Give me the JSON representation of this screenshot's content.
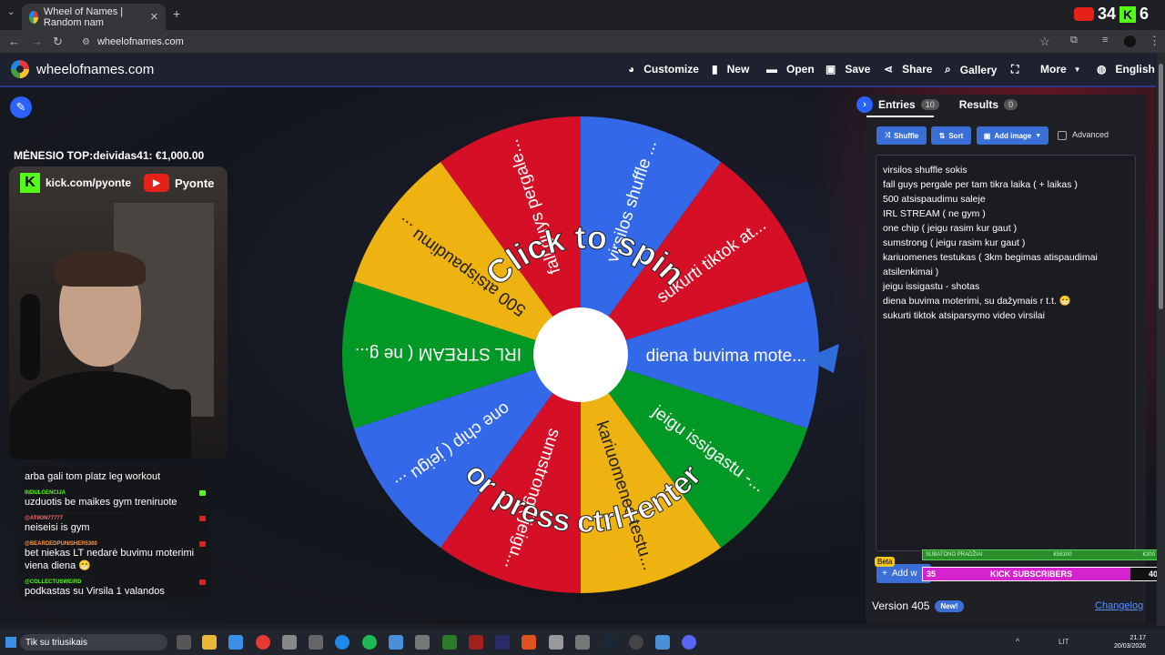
{
  "browser": {
    "tab_title": "Wheel of Names | Random nam",
    "url": "wheelofnames.com"
  },
  "overlay_counter": {
    "youtube": "34",
    "kick": "6"
  },
  "app": {
    "brand": "wheelofnames.com",
    "menu": [
      {
        "icon": "palette-icon",
        "label": "Customize"
      },
      {
        "icon": "file-icon",
        "label": "New"
      },
      {
        "icon": "folder-icon",
        "label": "Open"
      },
      {
        "icon": "save-icon",
        "label": "Save"
      },
      {
        "icon": "share-icon",
        "label": "Share"
      },
      {
        "icon": "search-icon",
        "label": "Gallery"
      },
      {
        "icon": "fullscreen-icon",
        "label": ""
      },
      {
        "icon": "chevron-down-icon",
        "label": "More"
      },
      {
        "icon": "globe-icon",
        "label": "English"
      }
    ]
  },
  "stream": {
    "top_line": "MĖNESIO TOP:deividas41: €1,000.00",
    "kick_url": "kick.com/pyonte",
    "youtube_name": "Pyonte"
  },
  "chat": [
    {
      "user": "",
      "user_color": "#888888",
      "text": "arba gali tom platz leg workout"
    },
    {
      "user": "INDULGENCIJA",
      "user_color": "#53fc18",
      "text": "uzduotis be maikes gym treniruote"
    },
    {
      "user": "@ATIKIN77777",
      "user_color": "#ff6b6b",
      "text": "neiseisi is gym"
    },
    {
      "user": "@BEARDEDPUNISHER5300",
      "user_color": "#ff9b4a",
      "text": "bet niekas LT nedarė buvimu moterimi viena diena 😁"
    },
    {
      "user": "@COLLECTUSWEIRD",
      "user_color": "#53fc18",
      "text": "podkastas su Virsila 1 valandos"
    }
  ],
  "wheel": {
    "center_prompt_top": "Click to spin",
    "center_prompt_bottom": "or press ctrl+enter",
    "segments": [
      {
        "label": "virsilos shuffle ...",
        "color": "#3369e8"
      },
      {
        "label": "sukurti tiktok at...",
        "color": "#d50f25"
      },
      {
        "label": "diena buvima mote...",
        "color": "#3369e8"
      },
      {
        "label": "jeigu issigastu -...",
        "color": "#009925"
      },
      {
        "label": "kariuomenes testu...",
        "color": "#eeb211"
      },
      {
        "label": "sumstrong ( jeigu...",
        "color": "#d50f25"
      },
      {
        "label": "one chip ( jeigu ...",
        "color": "#3369e8"
      },
      {
        "label": "IRL STREAM ( ne g...",
        "color": "#009925"
      },
      {
        "label": "500 atsispaudimu ...",
        "color": "#eeb211"
      },
      {
        "label": "fall guys pergale...",
        "color": "#d50f25"
      }
    ]
  },
  "panel": {
    "tab_entries": "Entries",
    "entries_count": "10",
    "tab_results": "Results",
    "results_count": "0",
    "shuffle": "Shuffle",
    "sort": "Sort",
    "add_image": "Add image",
    "advanced": "Advanced",
    "entries": [
      "virsilos shuffle sokis",
      "fall guys pergale per tam tikra laika ( + laikas )",
      "500 atsispaudimu saleje",
      "IRL STREAM ( ne gym )",
      "one chip ( jeigu rasim kur gaut )",
      "sumstrong ( jeigu rasim kur gaut )",
      "kariuomenes testukas ( 3km begimas atispaudimai atsilenkimai )",
      "jeigu issigastu - shotas",
      "diena buvima moterimi, su dažymais r t.t. 😁",
      "sukurti tiktok atsiparsymo video virsilai"
    ],
    "beta": "Beta",
    "add_wheel": "Add w",
    "version": "Version 405",
    "new_badge": "New!",
    "changelog": "Changelog"
  },
  "goals": {
    "sub_goal_label": "SUBATONO PRADŽIAI",
    "sub_goal_progress": "€58100",
    "sub_goal_target": "€300",
    "kick_current": "35",
    "kick_label": "KICK SUBSCRIBERS",
    "kick_target": "40"
  },
  "taskbar": {
    "search_text": "Tik su triusikais",
    "lang": "LIT",
    "time": "21.17",
    "date": "20/03/2026"
  }
}
